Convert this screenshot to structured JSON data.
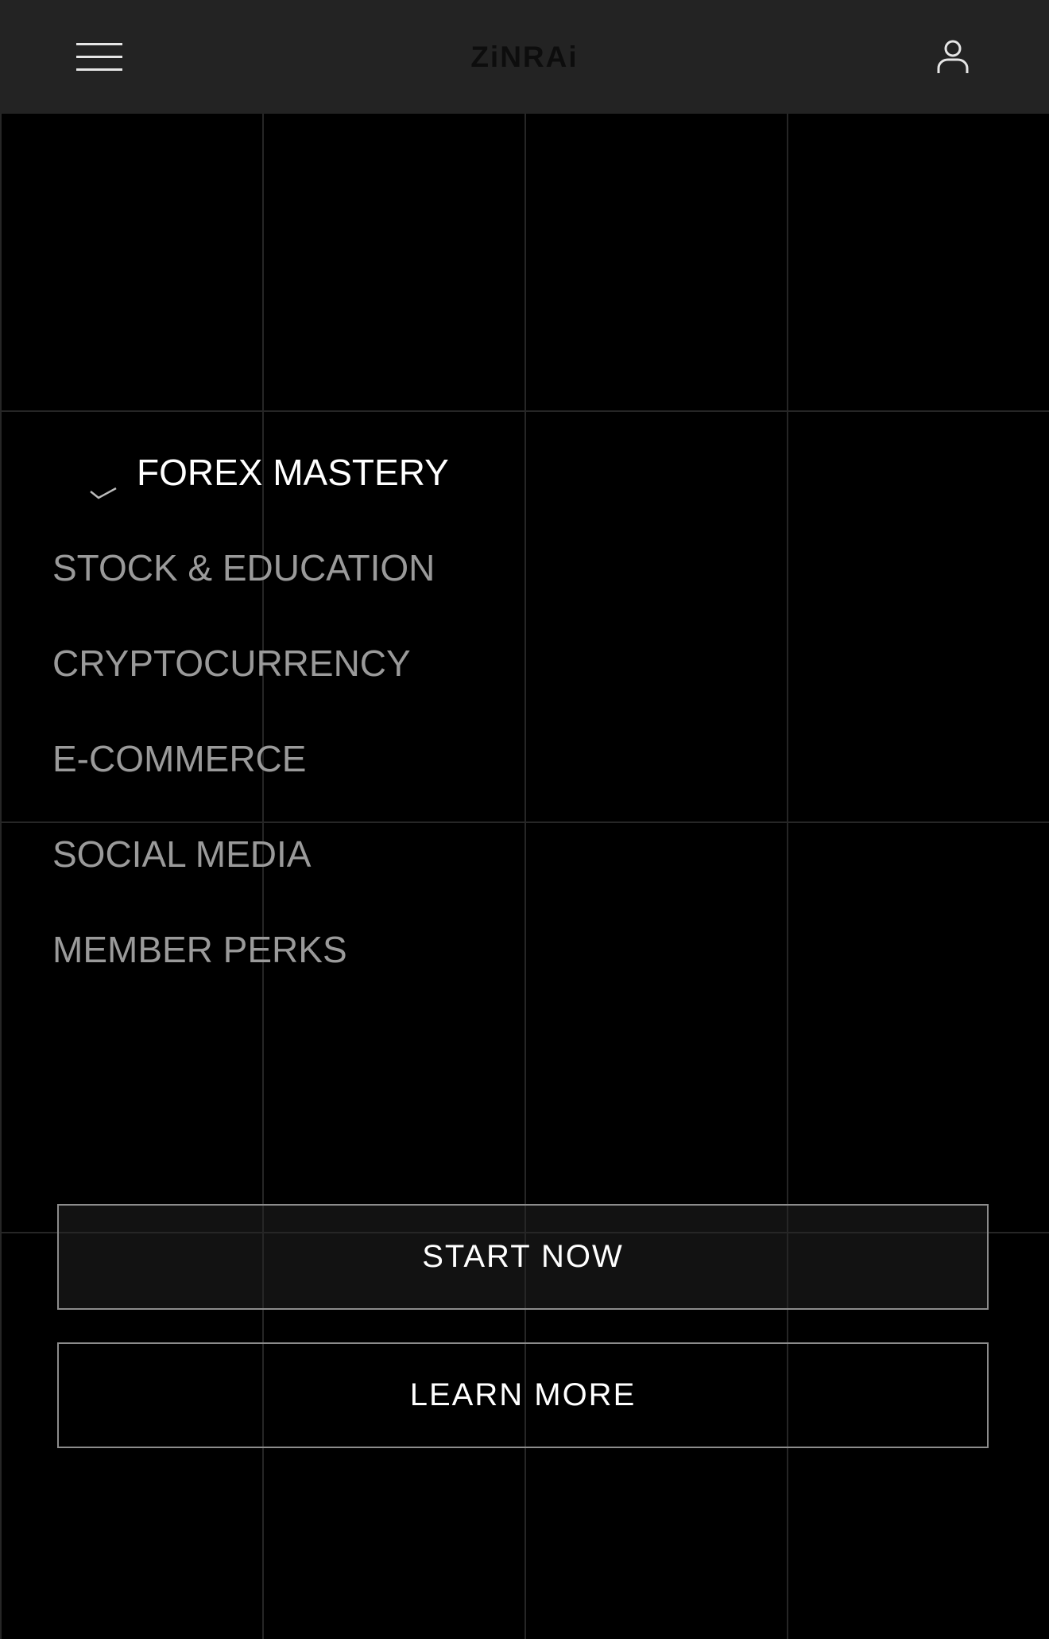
{
  "header": {
    "logo_text": "ZiNRAi",
    "menu_icon": "hamburger-menu-icon",
    "account_icon": "user-account-icon",
    "background_color": "#232323"
  },
  "nav": {
    "items": [
      {
        "label": "FOREX MASTERY",
        "active": true
      },
      {
        "label": "STOCK & EDUCATION",
        "active": false
      },
      {
        "label": "CRYPTOCURRENCY",
        "active": false
      },
      {
        "label": "E-COMMERCE",
        "active": false
      },
      {
        "label": "SOCIAL MEDIA",
        "active": false
      },
      {
        "label": "MEMBER PERKS",
        "active": false
      }
    ],
    "active_icon": "checkmark-icon",
    "active_color": "#ffffff",
    "inactive_color": "#9a9a9a"
  },
  "actions": {
    "primary_label": "START NOW",
    "secondary_label": "LEARN MORE"
  },
  "theme": {
    "background": "#000000",
    "grid_line": "#262626",
    "button_border": "#8c8c8c"
  }
}
